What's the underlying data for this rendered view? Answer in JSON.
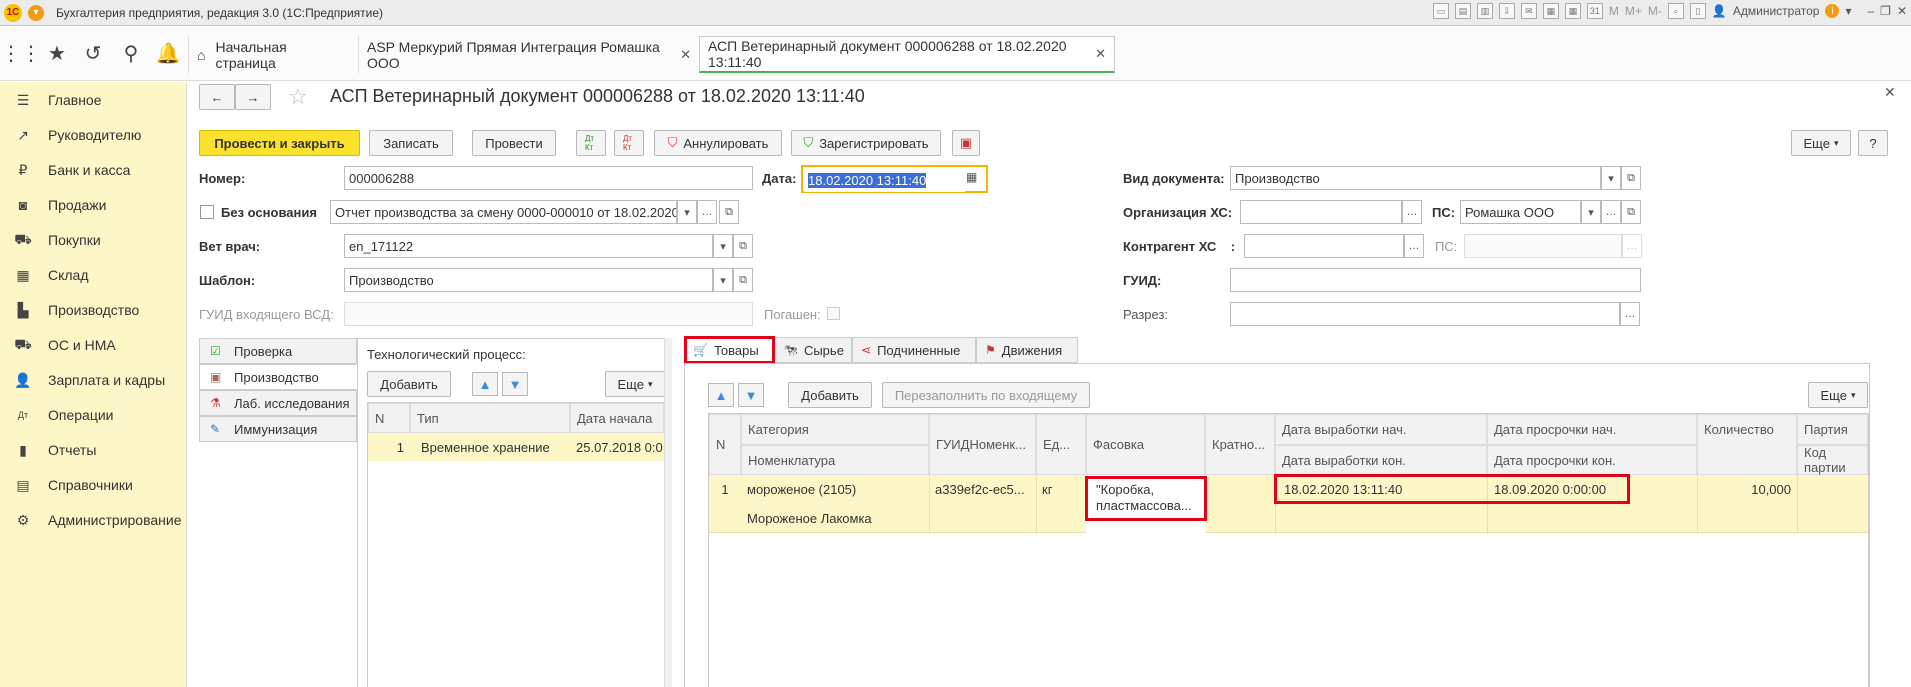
{
  "window": {
    "title": "Бухгалтерия предприятия, редакция 3.0  (1С:Предприятие)",
    "user": "Администратор",
    "toolbar_letters": [
      "M",
      "M+",
      "M-"
    ]
  },
  "tabs": [
    {
      "label": "Начальная страница"
    },
    {
      "label": "ASP Меркурий Прямая Интеграция Ромашка ООО"
    },
    {
      "label": "АСП Ветеринарный документ 000006288 от 18.02.2020 13:11:40"
    }
  ],
  "sidebar": {
    "items": [
      {
        "label": "Главное"
      },
      {
        "label": "Руководителю"
      },
      {
        "label": "Банк и касса"
      },
      {
        "label": "Продажи"
      },
      {
        "label": "Покупки"
      },
      {
        "label": "Склад"
      },
      {
        "label": "Производство"
      },
      {
        "label": "ОС и НМА"
      },
      {
        "label": "Зарплата и кадры"
      },
      {
        "label": "Операции"
      },
      {
        "label": "Отчеты"
      },
      {
        "label": "Справочники"
      },
      {
        "label": "Администрирование"
      }
    ]
  },
  "form": {
    "title": "АСП Ветеринарный документ 000006288 от 18.02.2020 13:11:40",
    "buttons": {
      "post_close": "Провести и закрыть",
      "write": "Записать",
      "post": "Провести",
      "dt_kt": "Дт Кт",
      "annul": "Аннулировать",
      "register": "Зарегистрировать",
      "more": "Еще",
      "help": "?"
    },
    "fields": {
      "number_label": "Номер:",
      "number_value": "000006288",
      "date_label": "Дата:",
      "date_value": "18.02.2020 13:11:40",
      "no_basis_label": "Без основания",
      "basis_value": "Отчет производства за смену 0000-000010 от 18.02.2020",
      "vet_label": "Вет врач:",
      "vet_value": "en_171122",
      "template_label": "Шаблон:",
      "template_value": "Производство",
      "guid_in_label": "ГУИД входящего ВСД:",
      "repaid_label": "Погашен:",
      "doc_type_label": "Вид документа:",
      "doc_type_value": "Производство",
      "org_label": "Организация ХС:",
      "org_value": "",
      "ps_label": "ПС:",
      "ps_value": "Ромашка ООО",
      "contractor_label": "Контрагент ХС    :",
      "ps2_label": "ПС:",
      "guid_label": "ГУИД:",
      "section_label": "Разрез:"
    },
    "pages": [
      {
        "label": "Проверка"
      },
      {
        "label": "Производство"
      },
      {
        "label": "Лаб. исследования"
      },
      {
        "label": "Иммунизация"
      }
    ],
    "process": {
      "label": "Технологический процесс:",
      "add": "Добавить",
      "more": "Еще",
      "columns": [
        "N",
        "Тип",
        "Дата начала"
      ],
      "rows": [
        {
          "n": "1",
          "type": "Временное хранение",
          "date": "25.07.2018 0:0"
        }
      ]
    },
    "goods_tabs": [
      {
        "label": "Товары"
      },
      {
        "label": "Сырье"
      },
      {
        "label": "Подчиненные"
      },
      {
        "label": "Движения"
      }
    ],
    "goods": {
      "add": "Добавить",
      "refill": "Перезаполнить по входящему",
      "more": "Еще",
      "header_top": [
        "N",
        "Категория",
        "ГУИДНоменк...",
        "Ед...",
        "Фасовка",
        "Кратно...",
        "Дата выработки нач.",
        "Дата просрочки нач.",
        "Количество",
        "Партия"
      ],
      "header_bottom": [
        "Номенклатура",
        "Дата выработки кон.",
        "Дата просрочки кон.",
        "Код партии"
      ],
      "rows": [
        {
          "n": "1",
          "category": "мороженое (2105)",
          "nomenclature": "Мороженое Лакомка",
          "guid": "a339ef2c-ec5...",
          "unit": "кг",
          "packing_1": "\"Коробка,",
          "packing_2": "пластмассова...",
          "prod_start": "18.02.2020 13:11:40",
          "expiry_start": "18.09.2020 0:00:00",
          "quantity": "10,000"
        }
      ]
    }
  }
}
